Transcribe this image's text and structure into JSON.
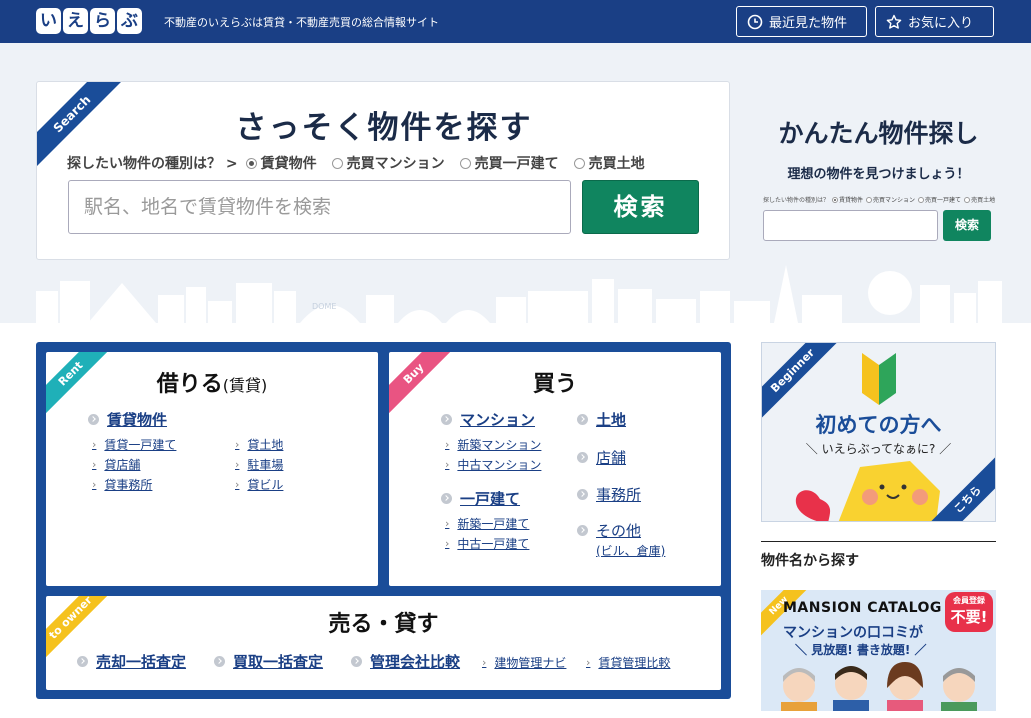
{
  "header": {
    "logo_chars": [
      "い",
      "え",
      "ら",
      "ぶ"
    ],
    "tagline": "不動産のいえらぶは賃貸・不動産売買の総合情報サイト",
    "recent_label": "最近見た物件",
    "favorite_label": "お気に入り"
  },
  "search": {
    "corner_label": "Search",
    "title": "さっそく物件を探す",
    "type_question": "探したい物件の種別は？",
    "types": [
      "賃貸物件",
      "売買マンション",
      "売買一戸建て",
      "売買土地"
    ],
    "selected_type": "賃貸物件",
    "placeholder": "駅名、地名で賃貸物件を検索",
    "button_label": "検索"
  },
  "side_search": {
    "title": "かんたん物件探し",
    "subtitle": "理想の物件を見つけましょう！",
    "type_question": "探したい物件の種別は？",
    "types": [
      "賃貸物件",
      "売買マンション",
      "売買一戸建て",
      "売買土地"
    ],
    "button_label": "検索"
  },
  "skyline": {
    "dome_label": "DOME"
  },
  "categories": {
    "rent": {
      "corner_label": "Rent",
      "title": "借りる",
      "title_suffix": "(賃貸)",
      "main_link": "賃貸物件",
      "sub_links_col1": [
        "賃貸一戸建て",
        "貸店舗",
        "貸事務所"
      ],
      "sub_links_col2": [
        "貸土地",
        "駐車場",
        "貸ビル"
      ]
    },
    "buy": {
      "corner_label": "Buy",
      "title": "買う",
      "mansion": "マンション",
      "mansion_subs": [
        "新築マンション",
        "中古マンション"
      ],
      "house": "一戸建て",
      "house_subs": [
        "新築一戸建て",
        "中古一戸建て"
      ],
      "land": "土地",
      "shop": "店舗",
      "office": "事務所",
      "other": "その他",
      "other_note": "(ビル、倉庫)"
    },
    "sell": {
      "corner_label": "to owner",
      "title": "売る・貸す",
      "links": [
        "売却一括査定",
        "買取一括査定",
        "管理会社比較"
      ],
      "sub_links": [
        "建物管理ナビ",
        "賃貸管理比較"
      ]
    }
  },
  "sidebar": {
    "beginner_corner": "Beginner",
    "beginner_title": "初めての方へ",
    "beginner_sub": "いえらぶってなぁに?",
    "beginner_here": "こちら",
    "section_title": "物件名から探す",
    "mansion_corner": "New",
    "mansion_title": "MANSION CATALOG",
    "badge_line1": "会員登録",
    "badge_line2": "不要!",
    "line1": "マンションの口コミが",
    "line2": "見放題! 書き放題!"
  }
}
